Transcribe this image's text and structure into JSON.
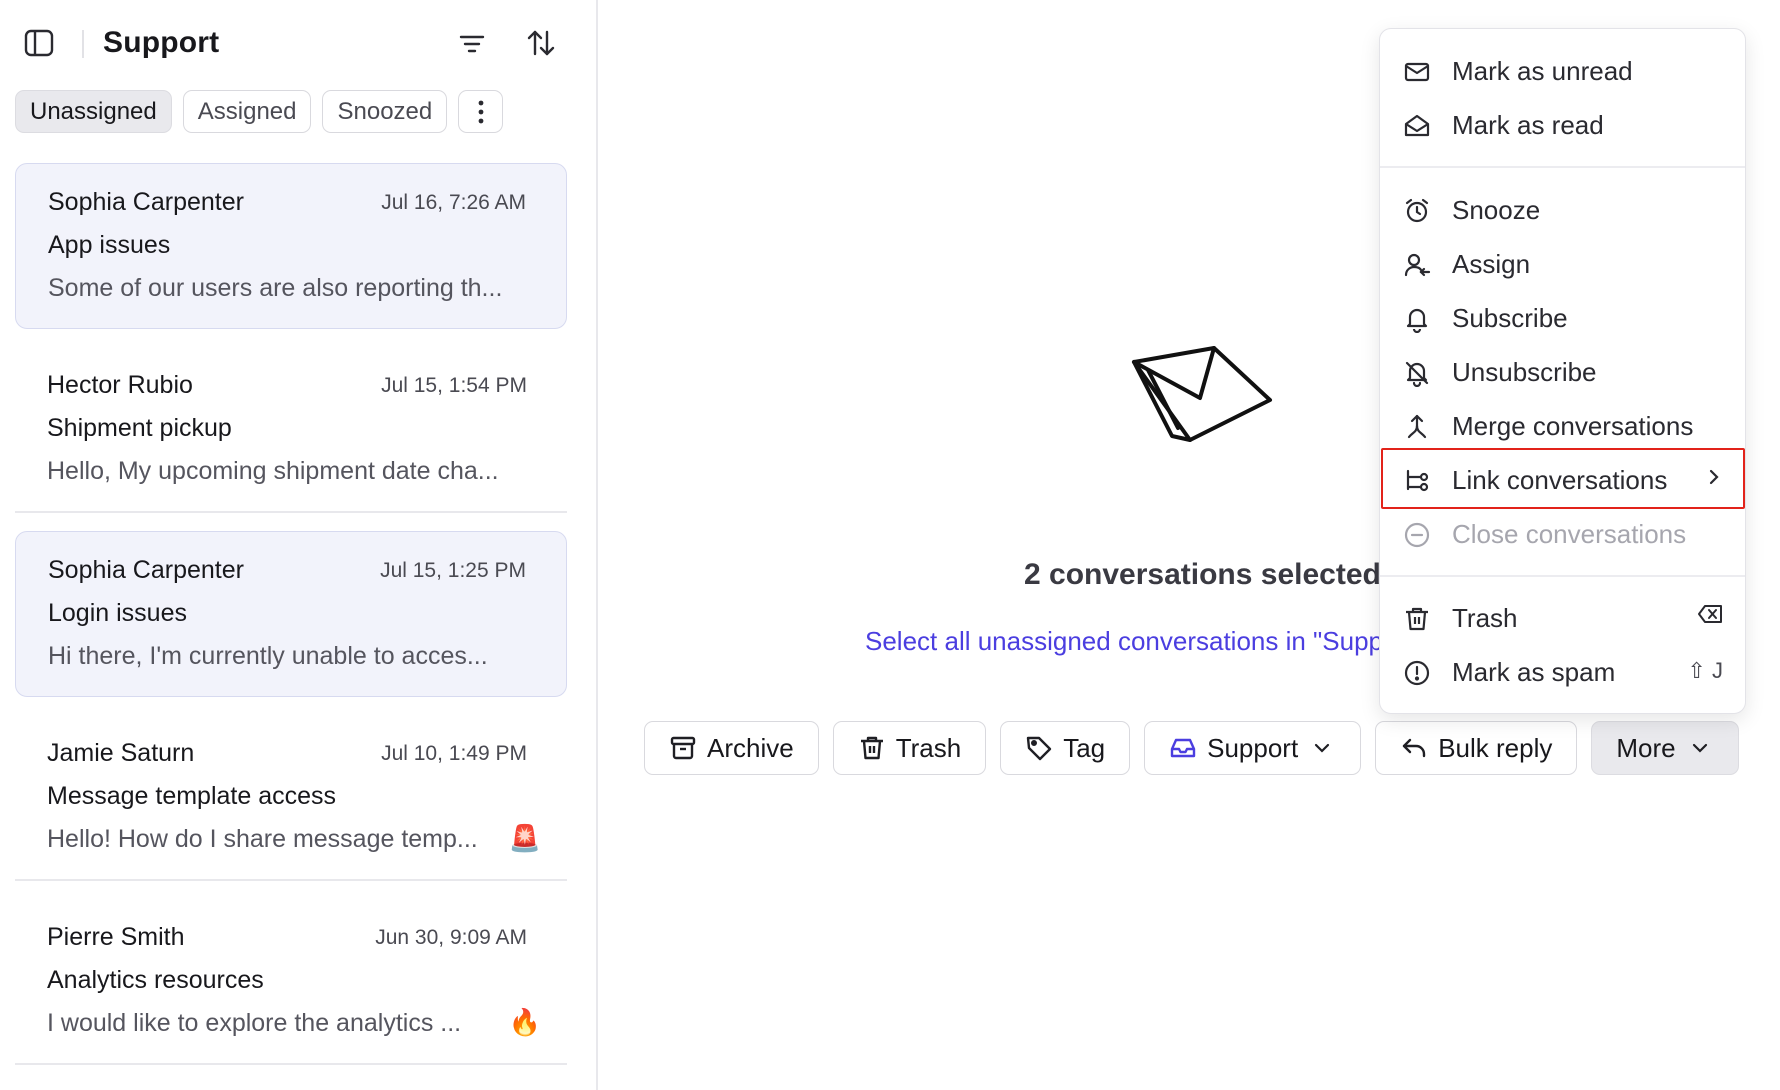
{
  "sidebar": {
    "title": "Support",
    "tabs": [
      {
        "label": "Unassigned",
        "active": true
      },
      {
        "label": "Assigned",
        "active": false
      },
      {
        "label": "Snoozed",
        "active": false
      }
    ],
    "conversations": [
      {
        "name": "Sophia Carpenter",
        "date": "Jul 16, 7:26 AM",
        "subject": "App issues",
        "preview": "Some of our users are also reporting th...",
        "emoji": "",
        "selected": true
      },
      {
        "name": "Hector Rubio",
        "date": "Jul 15, 1:54 PM",
        "subject": "Shipment pickup",
        "preview": "Hello, My upcoming shipment date cha...",
        "emoji": "",
        "selected": false
      },
      {
        "name": "Sophia Carpenter",
        "date": "Jul 15, 1:25 PM",
        "subject": "Login issues",
        "preview": "Hi there, I'm currently unable to acces...",
        "emoji": "",
        "selected": true
      },
      {
        "name": "Jamie Saturn",
        "date": "Jul 10, 1:49 PM",
        "subject": "Message template access",
        "preview": "Hello! How do I share message temp...",
        "emoji": "🚨",
        "selected": false
      },
      {
        "name": "Pierre Smith",
        "date": "Jun 30, 9:09 AM",
        "subject": "Analytics resources",
        "preview": "I would like to explore the analytics ...",
        "emoji": "🔥",
        "selected": false
      }
    ]
  },
  "main": {
    "selected_count_text": "2 conversations selected",
    "select_all_link": "Select all unassigned conversations in \"Support\"",
    "actions": {
      "archive": "Archive",
      "trash": "Trash",
      "tag": "Tag",
      "inbox": "Support",
      "bulk_reply": "Bulk reply",
      "more": "More"
    }
  },
  "menu": {
    "items": [
      {
        "label": "Mark as unread",
        "icon": "envelope-icon"
      },
      {
        "label": "Mark as read",
        "icon": "envelope-open-icon"
      },
      {
        "label": "Snooze",
        "icon": "alarm-clock-icon"
      },
      {
        "label": "Assign",
        "icon": "user-assign-icon"
      },
      {
        "label": "Subscribe",
        "icon": "bell-icon"
      },
      {
        "label": "Unsubscribe",
        "icon": "bell-off-icon"
      },
      {
        "label": "Merge conversations",
        "icon": "merge-icon"
      },
      {
        "label": "Link conversations",
        "icon": "link-conversations-icon",
        "highlighted": true
      },
      {
        "label": "Close conversations",
        "icon": "minus-circle-icon",
        "disabled": true
      },
      {
        "label": "Trash",
        "icon": "trash-icon"
      },
      {
        "label": "Mark as spam",
        "icon": "alert-circle-icon",
        "shortcut": "⇧ J"
      }
    ]
  },
  "colors": {
    "accent": "#4b3ee0",
    "selected_bg": "#f2f3fb",
    "highlight_border": "#e2231a"
  }
}
